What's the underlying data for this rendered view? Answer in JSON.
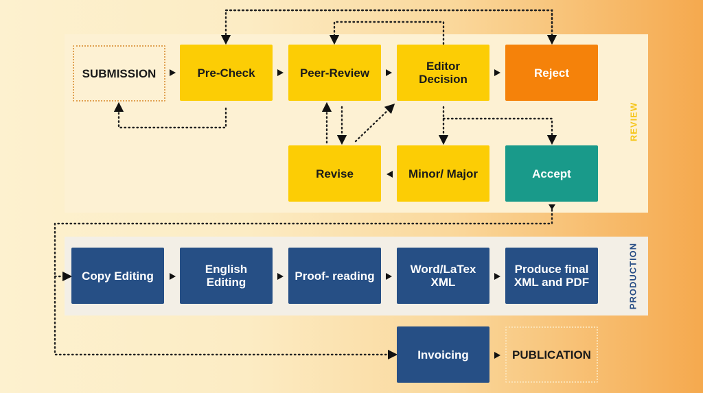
{
  "panels": {
    "review_label": "REVIEW",
    "production_label": "PRODUCTION"
  },
  "nodes": {
    "submission": "SUBMISSION",
    "pre_check": "Pre-Check",
    "peer_review": "Peer-Review",
    "editor_decision": "Editor Decision",
    "reject": "Reject",
    "revise": "Revise",
    "minor_major": "Minor/ Major",
    "accept": "Accept",
    "copy_editing": "Copy Editing",
    "english_editing": "English Editing",
    "proofreading": "Proof- reading",
    "word_latex_xml": "Word/LaTex XML",
    "produce_final": "Produce final XML and PDF",
    "invoicing": "Invoicing",
    "publication": "PUBLICATION"
  },
  "colors": {
    "yellow": "#fccd05",
    "orange": "#f5820a",
    "teal": "#199a8a",
    "navy": "#264f85"
  }
}
